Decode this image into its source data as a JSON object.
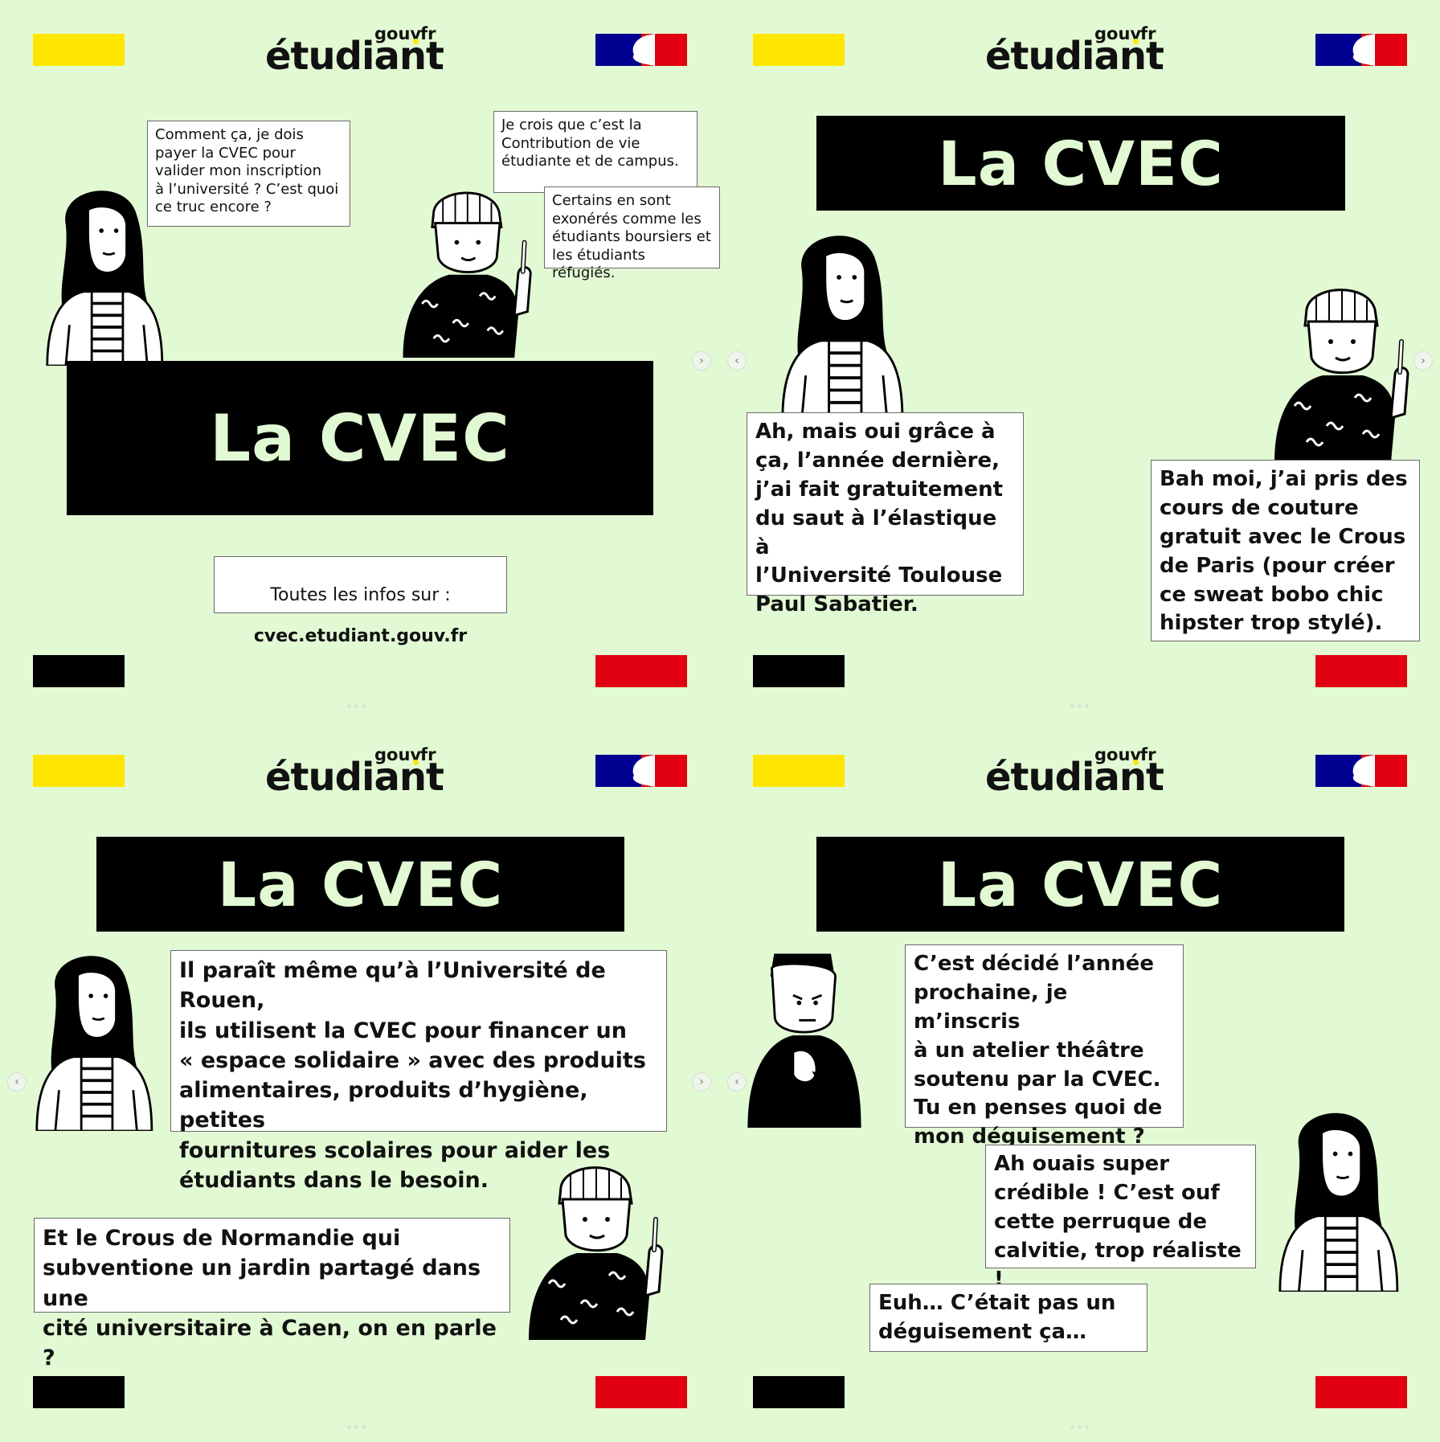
{
  "logo": {
    "word": "étudiant",
    "gouv": "gouv",
    "fr": "fr"
  },
  "colors": {
    "background": "#e2fad4",
    "yellow": "#ffe600",
    "blue": "#000091",
    "red": "#e1000f",
    "black": "#000000"
  },
  "title": "La CVEC",
  "panel1": {
    "bubble_left": "Comment ça, je dois\npayer la CVEC pour\nvalider mon inscription\nà l’université ? C’est quoi\nce truc encore ?",
    "bubble_right_1": "Je crois que c’est la\nContribution de vie\nétudiante et de campus.",
    "bubble_right_2": "Certains en sont\nexonérés comme les\nétudiants boursiers et\nles étudiants réfugiés.",
    "info_line1": "Toutes les infos sur :",
    "info_line2": "cvec.etudiant.gouv.fr"
  },
  "panel2": {
    "bubble_left": "Ah, mais oui grâce à\nça, l’année dernière,\nj’ai fait gratuitement\ndu saut à l’élastique à\nl’Université Toulouse\nPaul Sabatier.",
    "bubble_right": "Bah moi, j’ai pris des\ncours de couture\ngratuit avec le Crous\nde Paris (pour créer\nce sweat bobo chic\nhipster trop stylé)."
  },
  "panel3": {
    "bubble_top": "Il paraît même qu’à l’Université de Rouen,\nils utilisent la CVEC pour financer un\n« espace solidaire » avec des produits\nalimentaires, produits d’hygiène, petites\nfournitures scolaires pour aider les\nétudiants dans le besoin.",
    "bubble_bottom": "Et le Crous de Normandie qui\nsubventione un jardin partagé dans une\ncité universitaire à Caen, on en parle ?"
  },
  "panel4": {
    "bubble_top": "C’est décidé l’année\nprochaine, je m’inscris\nà un atelier théâtre\nsoutenu par la CVEC.\nTu en penses quoi de\nmon déguisement ?",
    "bubble_middle": "Ah ouais super\ncrédible ! C’est ouf\ncette perruque de\ncalvitie, trop réaliste !",
    "bubble_bottom": "Euh… C’était pas un\ndéguisement ça…"
  },
  "nav": {
    "prev": "‹",
    "next": "›"
  }
}
